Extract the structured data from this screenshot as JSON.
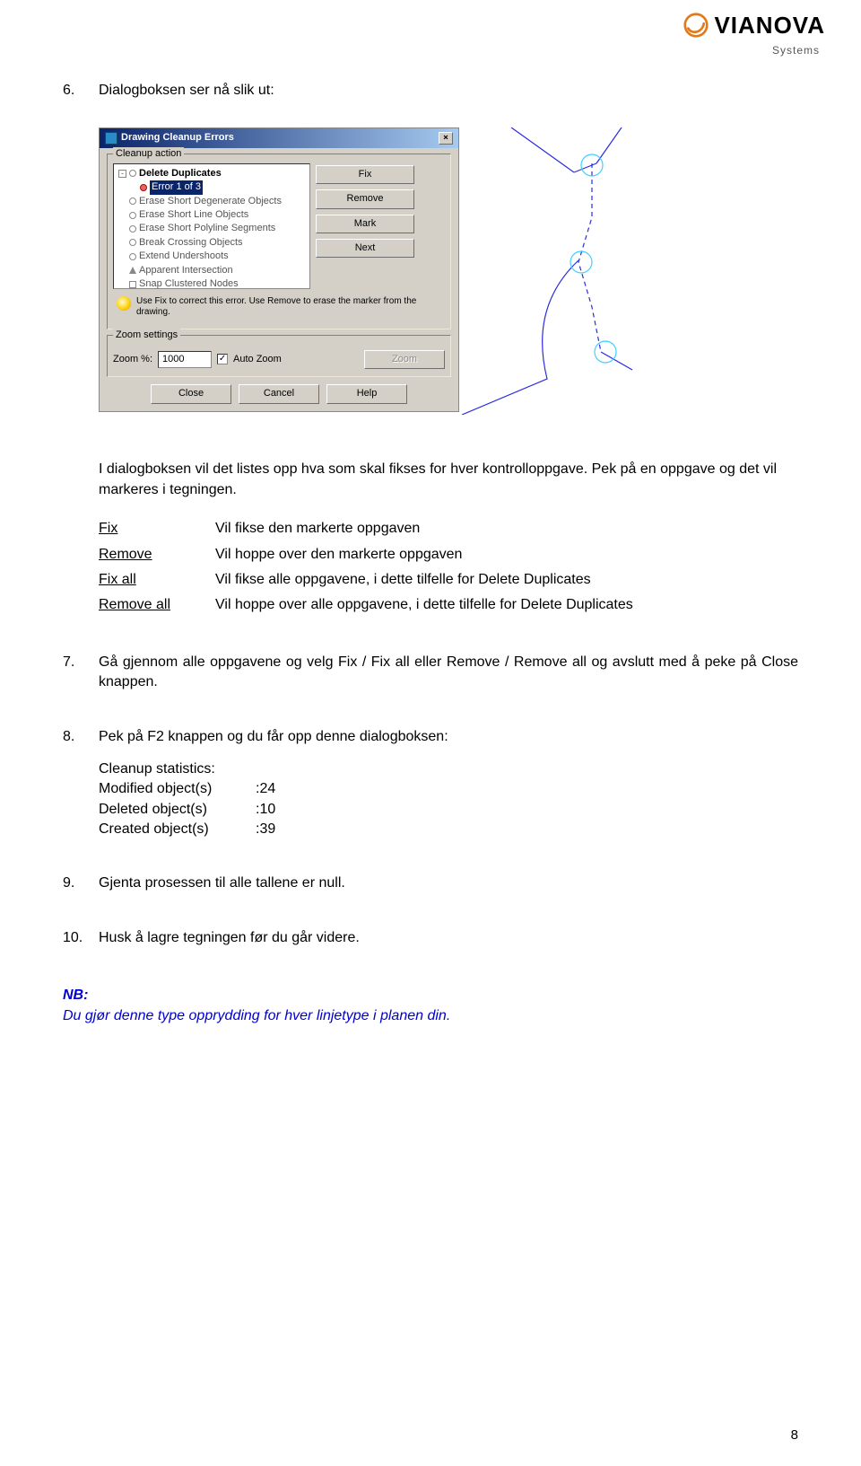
{
  "logo": {
    "brand": "VIANOVA",
    "sub": "Systems"
  },
  "section6": {
    "num": "6.",
    "text": "Dialogboksen ser nå slik ut:"
  },
  "dialog": {
    "title": "Drawing Cleanup Errors",
    "action_label": "Cleanup action",
    "tree": {
      "root": "Delete Duplicates",
      "sel": "Error 1 of 3",
      "items": [
        "Erase Short Degenerate Objects",
        "Erase Short Line Objects",
        "Erase Short Polyline Segments",
        "Break Crossing Objects",
        "Extend Undershoots",
        "Apparent Intersection",
        "Snap Clustered Nodes"
      ]
    },
    "buttons": {
      "fix": "Fix",
      "remove": "Remove",
      "mark": "Mark",
      "next": "Next",
      "zoom": "Zoom",
      "close": "Close",
      "cancel": "Cancel",
      "help": "Help"
    },
    "hint": "Use Fix to correct this error. Use Remove to erase the marker from the drawing.",
    "zoom_label": "Zoom settings",
    "zoom_pct_label": "Zoom %:",
    "zoom_value": "1000",
    "auto_zoom": "Auto Zoom",
    "auto_checked": "✓"
  },
  "para_below_dialog": "I dialogboksen vil det listes opp hva som skal fikses for hver kontrolloppgave. Pek på en oppgave og det vil markeres i tegningen.",
  "defs": {
    "fix": {
      "k": "Fix",
      "v": "Vil fikse den markerte oppgaven"
    },
    "remove": {
      "k": "Remove",
      "v": "Vil hoppe over den markerte oppgaven"
    },
    "fixall": {
      "k": "Fix all",
      "v": "Vil fikse alle oppgavene,  i dette tilfelle for Delete Duplicates"
    },
    "removeall": {
      "k": "Remove all",
      "v": "Vil hoppe over alle oppgavene, i dette tilfelle for Delete Duplicates"
    }
  },
  "step7": {
    "n": "7.",
    "c": "Gå gjennom alle oppgavene og velg Fix  / Fix all eller Remove / Remove all og avslutt med å peke på Close knappen."
  },
  "step8": {
    "n": "8.",
    "c": "Pek på F2 knappen og du får opp denne dialogboksen:"
  },
  "stats": {
    "title": "Cleanup statistics:",
    "modified": {
      "k": "Modified object(s)",
      "v": ":24"
    },
    "deleted": {
      "k": "Deleted object(s)",
      "v": ":10"
    },
    "created": {
      "k": "Created object(s)",
      "v": ":39"
    }
  },
  "step9": {
    "n": "9.",
    "c": "Gjenta prosessen til alle tallene er null."
  },
  "step10": {
    "n": "10.",
    "c": "Husk å lagre tegningen før du går videre."
  },
  "nb": {
    "label": "NB:",
    "text": "Du gjør denne type opprydding for hver linjetype i planen din."
  },
  "page_number": "8"
}
